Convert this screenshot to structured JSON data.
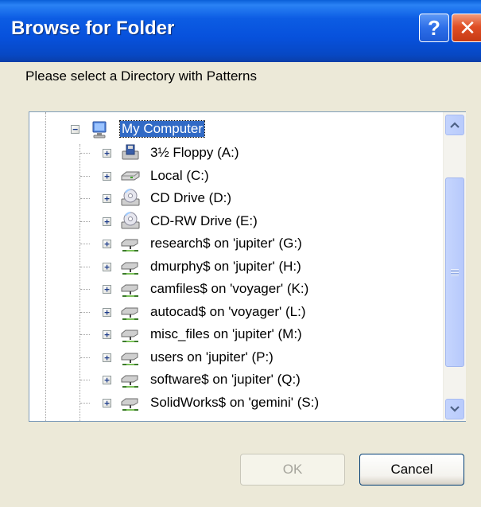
{
  "window": {
    "title": "Browse for Folder",
    "help_glyph": "?",
    "close_glyph": "✕"
  },
  "description": "Please select a Directory with Patterns",
  "tree": {
    "root": {
      "label": "My Computer",
      "icon": "my-computer-icon",
      "expander": "−"
    },
    "items": [
      {
        "label": "3½ Floppy (A:)",
        "icon": "floppy-drive-icon",
        "expander": "+"
      },
      {
        "label": "Local  (C:)",
        "icon": "hard-drive-icon",
        "expander": "+"
      },
      {
        "label": "CD Drive (D:)",
        "icon": "cd-drive-icon",
        "expander": "+"
      },
      {
        "label": "CD-RW Drive (E:)",
        "icon": "cd-drive-icon",
        "expander": "+"
      },
      {
        "label": "research$ on 'jupiter' (G:)",
        "icon": "network-drive-icon",
        "expander": "+"
      },
      {
        "label": "dmurphy$ on 'jupiter' (H:)",
        "icon": "network-drive-icon",
        "expander": "+"
      },
      {
        "label": "camfiles$ on 'voyager' (K:)",
        "icon": "network-drive-icon",
        "expander": "+"
      },
      {
        "label": "autocad$ on 'voyager' (L:)",
        "icon": "network-drive-icon",
        "expander": "+"
      },
      {
        "label": "misc_files on 'jupiter' (M:)",
        "icon": "network-drive-icon",
        "expander": "+"
      },
      {
        "label": "users on 'jupiter' (P:)",
        "icon": "network-drive-icon",
        "expander": "+"
      },
      {
        "label": "software$ on 'jupiter' (Q:)",
        "icon": "network-drive-icon",
        "expander": "+"
      },
      {
        "label": "SolidWorks$ on 'gemini' (S:)",
        "icon": "network-drive-icon",
        "expander": "+"
      }
    ]
  },
  "buttons": {
    "ok_label": "OK",
    "ok_enabled": false,
    "cancel_label": "Cancel"
  },
  "colors": {
    "titlebar": "#0751dc",
    "selection": "#316ac5",
    "dialog_bg": "#ece9d8"
  }
}
